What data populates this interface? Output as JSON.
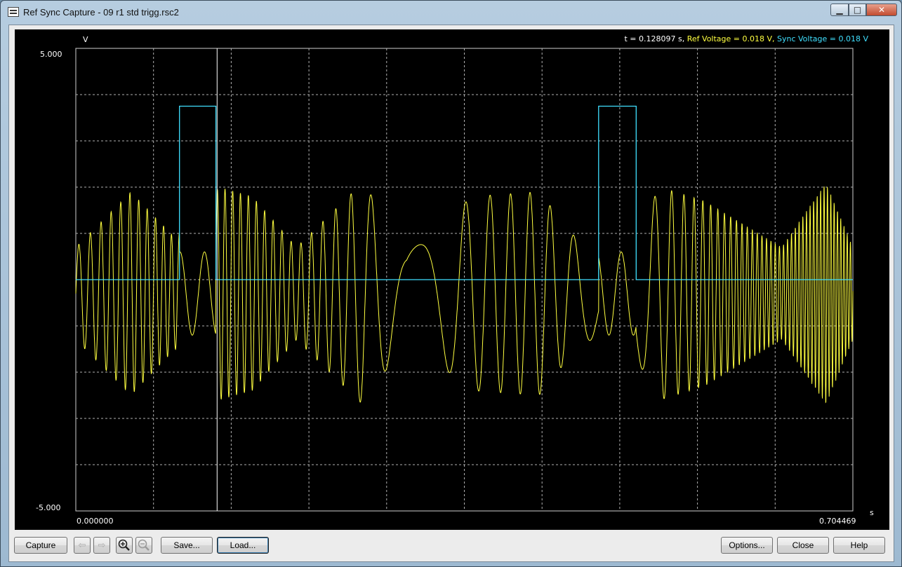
{
  "window": {
    "title": "Ref Sync Capture - 09 r1 std trigg.rsc2",
    "controls": {
      "minimize": "▁",
      "maximize": "□",
      "close": "✕"
    }
  },
  "plot": {
    "y_unit": "V",
    "x_unit": "s",
    "y_max_label": "5.000",
    "y_min_label": "-5.000",
    "x_min_label": "0.000000",
    "x_max_label": "0.704469",
    "readout": {
      "time": "t = 0.128097 s, ",
      "ref": "Ref Voltage =  0.018 V, ",
      "sync": "Sync Voltage =  0.018 V"
    },
    "colors": {
      "background": "#000000",
      "grid": "#b0b0b0",
      "ref": "#ffff40",
      "sync": "#40e0ff",
      "cursor": "#ffffff"
    }
  },
  "chart_data": {
    "type": "line",
    "xlabel": "s",
    "ylabel": "V",
    "xlim": [
      0.0,
      0.704469
    ],
    "ylim": [
      -5.0,
      5.0
    ],
    "grid": true,
    "cursor_x": 0.128097,
    "series": [
      {
        "name": "Sync Voltage",
        "color": "#40e0ff",
        "x": [
          0.0,
          0.094,
          0.094,
          0.127,
          0.127,
          0.474,
          0.474,
          0.508,
          0.508,
          0.704469
        ],
        "y": [
          0.0,
          0.0,
          3.75,
          3.75,
          0.0,
          0.0,
          3.75,
          3.75,
          0.0,
          0.0
        ]
      },
      {
        "name": "Ref Voltage",
        "color": "#ffff40",
        "envelope_x": [
          0.0,
          0.05,
          0.09,
          0.13,
          0.16,
          0.2,
          0.26,
          0.3,
          0.36,
          0.42,
          0.46,
          0.5,
          0.53,
          0.57,
          0.64,
          0.68,
          0.704469
        ],
        "envelope_y": [
          1.0,
          2.2,
          1.2,
          2.3,
          2.1,
          1.0,
          2.4,
          1.0,
          2.1,
          2.2,
          1.0,
          1.1,
          2.3,
          2.0,
          1.0,
          2.4,
          1.0
        ]
      }
    ]
  },
  "toolbar": {
    "capture": "Capture",
    "back_icon": "⇦",
    "forward_icon": "⇨",
    "zoom_in_icon": "+",
    "zoom_out_icon": "−",
    "save": "Save...",
    "load": "Load...",
    "options": "Options...",
    "close": "Close",
    "help": "Help"
  }
}
